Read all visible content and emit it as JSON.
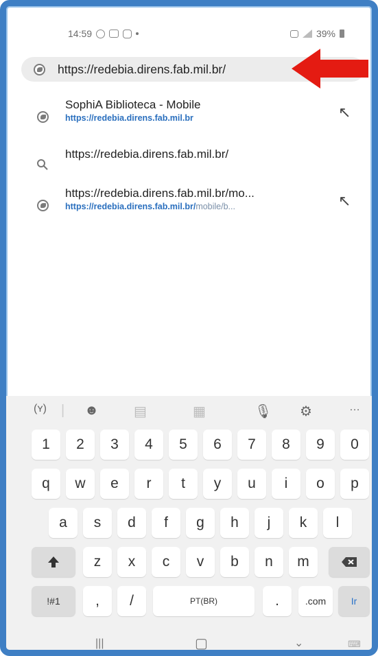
{
  "status": {
    "time": "14:59",
    "battery": "39%"
  },
  "address_bar": {
    "url": "https://redebia.direns.fab.mil.br/"
  },
  "suggestions": [
    {
      "title": "SophiA Biblioteca - Mobile",
      "sub_main": "https://redebia.direns.fab.mil.br",
      "sub_rest": "",
      "icon": "globe-icon",
      "has_fill": true
    },
    {
      "title": "https://redebia.direns.fab.mil.br/",
      "sub_main": "",
      "sub_rest": "",
      "icon": "search-icon",
      "has_fill": false
    },
    {
      "title": "https://redebia.direns.fab.mil.br/mo...",
      "sub_main": "https://redebia.direns.fab.mil.br/",
      "sub_rest": "mobile/b...",
      "icon": "globe-icon",
      "has_fill": true
    }
  ],
  "keyboard": {
    "numbers": [
      "1",
      "2",
      "3",
      "4",
      "5",
      "6",
      "7",
      "8",
      "9",
      "0"
    ],
    "row1": [
      "q",
      "w",
      "e",
      "r",
      "t",
      "y",
      "u",
      "i",
      "o",
      "p"
    ],
    "row2": [
      "a",
      "s",
      "d",
      "f",
      "g",
      "h",
      "j",
      "k",
      "l"
    ],
    "row3": [
      "z",
      "x",
      "c",
      "v",
      "b",
      "n",
      "m"
    ],
    "symbols_key": "!#1",
    "comma_key": ",",
    "slash_key": "/",
    "space_key": "PT(BR)",
    "period_key": ".",
    "dotcom_key": ".com",
    "go_key": "Ir"
  }
}
